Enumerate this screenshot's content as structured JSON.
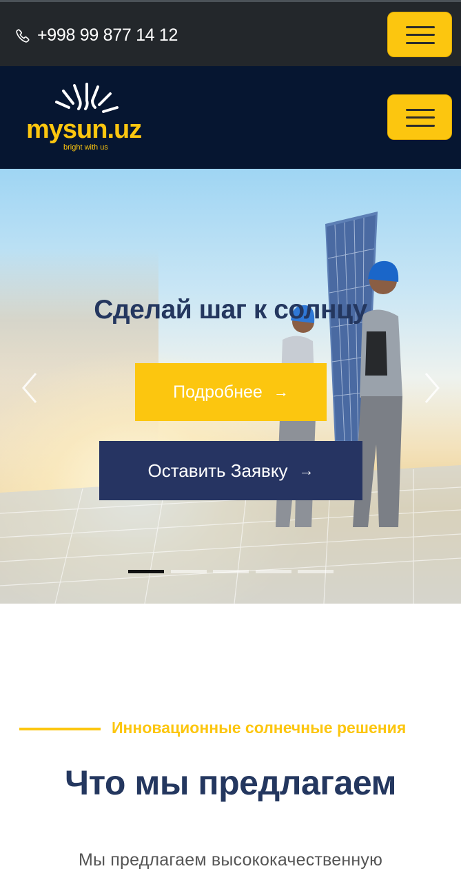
{
  "topbar": {
    "phone_icon": "phone-icon",
    "phone": "+998 99 877 14 12",
    "menu_icon": "hamburger-icon"
  },
  "navbar": {
    "logo": {
      "text": "mysun.uz",
      "tagline": "bright with us"
    },
    "menu_icon": "hamburger-icon"
  },
  "hero": {
    "title": "Сделай шаг к солнцу",
    "more_button": "Подробнее",
    "apply_button": "Оставить Заявку",
    "button_arrow": "→",
    "prev_icon": "chevron-left-icon",
    "next_icon": "chevron-right-icon",
    "slides_total": 5,
    "active_slide": 1
  },
  "section": {
    "subtitle": "Инновационные солнечные решения",
    "title": "Что мы предлагаем",
    "text": "Мы предлагаем высококачественную"
  },
  "colors": {
    "accent_yellow": "#fcc60f",
    "navy": "#263462",
    "navbar_bg": "#061631",
    "topbar_bg": "#23272b"
  }
}
